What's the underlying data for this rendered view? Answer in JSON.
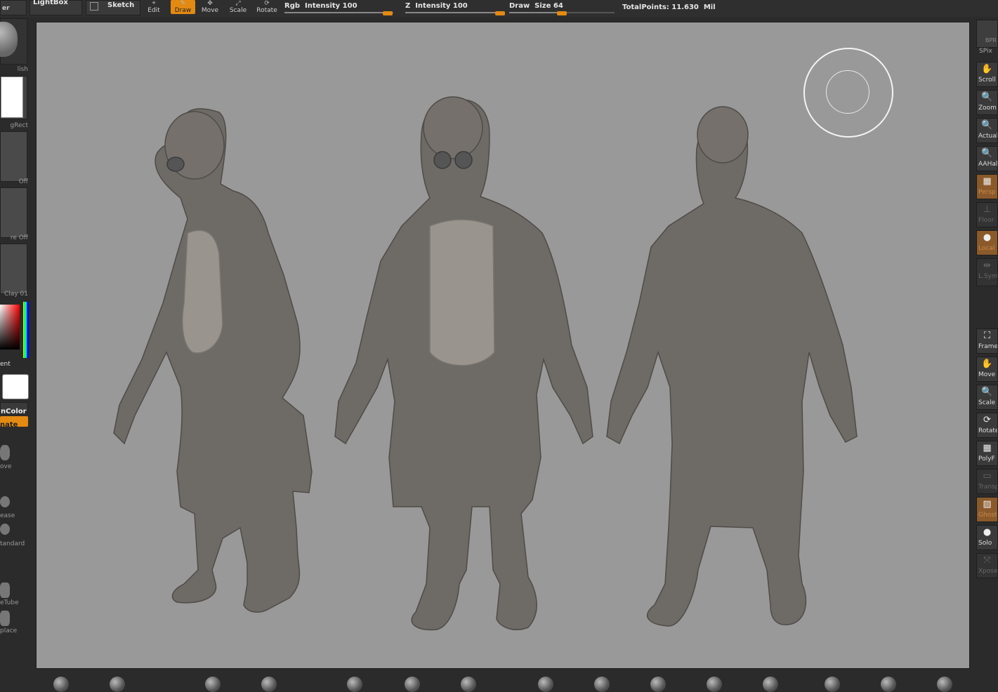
{
  "topbar": {
    "lightbox_label": "LightBox",
    "sketch_label": "Sketch",
    "tools": [
      {
        "label": "Edit",
        "icon": "edit-icon"
      },
      {
        "label": "Draw",
        "icon": "draw-icon"
      },
      {
        "label": "Move",
        "icon": "move-icon"
      },
      {
        "label": "Scale",
        "icon": "scale-icon"
      },
      {
        "label": "Rotate",
        "icon": "rotate-icon"
      }
    ],
    "rgb_intensity": {
      "label": "Rgb  Intensity 100",
      "value": 100
    },
    "z_intensity": {
      "label": "Z  Intensity 100",
      "value": 100
    },
    "draw_size": {
      "label": "Draw  Size 64",
      "value": 64
    },
    "total_points": "TotalPoints: 11.630  Mil",
    "accent_color": "#e38a13"
  },
  "leftpanel": {
    "labels": [
      "lish",
      "gRect",
      "Off",
      "re  Off",
      "Clay  01",
      "ent",
      "nColor",
      "nate",
      "ove",
      "ease",
      "tandard",
      "eTube",
      "place"
    ]
  },
  "rightpanel": {
    "buttons": [
      {
        "label": "Scroll",
        "icon": "hand-scroll-icon"
      },
      {
        "label": "Zoom",
        "icon": "zoom-icon"
      },
      {
        "label": "Actual",
        "icon": "actual-size-icon"
      },
      {
        "label": "AAHalf",
        "icon": "aahalf-icon"
      },
      {
        "label": "Persp",
        "icon": "perspective-icon"
      },
      {
        "label": "Floor",
        "icon": "floor-icon"
      },
      {
        "label": "Local",
        "icon": "local-icon"
      },
      {
        "label": "L.Sym",
        "icon": "local-symmetry-icon"
      },
      {
        "label": "Frame",
        "icon": "frame-icon"
      },
      {
        "label": "Move",
        "icon": "move-icon"
      },
      {
        "label": "Scale",
        "icon": "scale-icon"
      },
      {
        "label": "Rotate",
        "icon": "rotate-icon"
      },
      {
        "label": "PolyF",
        "icon": "polyframe-icon"
      },
      {
        "label": "Transp",
        "icon": "transparency-icon"
      },
      {
        "label": "Ghost",
        "icon": "ghost-icon"
      },
      {
        "label": "Solo",
        "icon": "solo-icon"
      },
      {
        "label": "Xpose",
        "icon": "xpose-icon"
      }
    ],
    "bpr_label": "BPR",
    "spix_label": "SPix"
  },
  "canvas": {
    "background_color": "#999999",
    "model_color": "#6e6a66"
  }
}
